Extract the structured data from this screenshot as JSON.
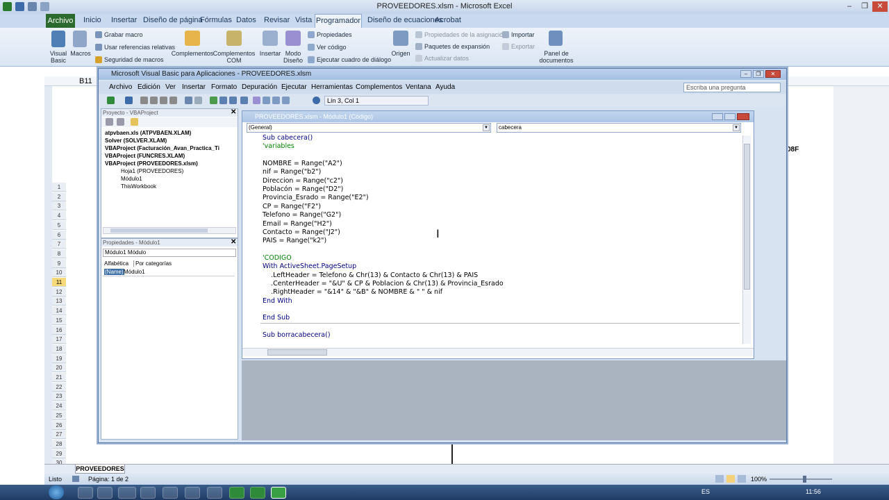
{
  "excel": {
    "title": "PROVEEDORES.xlsm - Microsoft Excel",
    "tabs": [
      "Inicio",
      "Insertar",
      "Diseño de página",
      "Fórmulas",
      "Datos",
      "Revisar",
      "Vista",
      "Programador",
      "Diseño de ecuaciones",
      "Acrobat"
    ],
    "file_tab": "Archivo",
    "ribbon": {
      "visual_basic": "Visual Basic",
      "macros": "Macros",
      "grabar": "Grabar macro",
      "relativas": "Usar referencias relativas",
      "seguridad": "Seguridad de macros",
      "complementos": "Complementos",
      "complementos_com": "Complementos COM",
      "insertar": "Insertar",
      "modo_diseno": "Modo Diseño",
      "propiedades": "Propiedades",
      "ver_codigo": "Ver código",
      "ejecutar": "Ejecutar cuadro de diálogo",
      "origen": "Origen",
      "prop_asig": "Propiedades de la asignación",
      "paquetes": "Paquetes de expansión",
      "actualizar": "Actualizar datos",
      "importar": "Importar",
      "exportar": "Exportar",
      "panel": "Panel de documentos"
    },
    "namebox": "B11",
    "cell_fragment": "08F",
    "rows": [
      "1",
      "2",
      "3",
      "4",
      "5",
      "6",
      "7",
      "8",
      "9",
      "10",
      "11",
      "12",
      "13",
      "14",
      "15",
      "16",
      "17",
      "18",
      "19",
      "20",
      "21",
      "22",
      "23",
      "24",
      "25",
      "26",
      "27",
      "28",
      "29",
      "30"
    ],
    "sheet_tab": "PROVEEDORES",
    "status": {
      "ready": "Listo",
      "page": "Página: 1 de 2",
      "zoom": "100%"
    },
    "clock": "11:56",
    "lang": "ES"
  },
  "vba": {
    "title": "Microsoft Visual Basic para Aplicaciones - PROVEEDORES.xlsm",
    "menus": [
      "Archivo",
      "Edición",
      "Ver",
      "Insertar",
      "Formato",
      "Depuración",
      "Ejecutar",
      "Herramientas",
      "Complementos",
      "Ventana",
      "Ayuda"
    ],
    "ask_placeholder": "Escriba una pregunta",
    "position": "Lín 3, Col 1",
    "project_title": "Proyecto - VBAProject",
    "tree": [
      "atpvbaen.xls (ATPVBAEN.XLAM)",
      "Solver (SOLVER.XLAM)",
      "VBAProject (Facturación_Avan_Practica_Ti",
      "VBAProject (FUNCRES.XLAM)",
      "VBAProject (PROVEEDORES.xlsm)",
      "Hoja1 (PROVEEDORES)",
      "Módulo1",
      "ThisWorkbook"
    ],
    "props_title": "Propiedades - Módulo1",
    "props_combo": "Módulo1 Módulo",
    "props_tabs": [
      "Alfabética",
      "Por categorías"
    ],
    "props_name_key": "(Name)",
    "props_name_val": "Módulo1",
    "code_title": "PROVEEDORES.xlsm - Módulo1 (Código)",
    "combo_left": "(General)",
    "combo_right": "cabecera",
    "code": [
      "Sub cabecera()",
      "'variables",
      "",
      "NOMBRE = Range(\"A2\")",
      "nif = Range(\"b2\")",
      "Direccion = Range(\"c2\")",
      "Poblacón = Range(\"D2\")",
      "Provincia_Esrado = Range(\"E2\")",
      "CP = Range(\"F2\")",
      "Telefono = Range(\"G2\")",
      "Email = Range(\"H2\")",
      "Contacto = Range(\"J2\")",
      "PAIS = Range(\"k2\")",
      "",
      "'CODIGO",
      "With ActiveSheet.PageSetup",
      "    .LeftHeader = Telefono & Chr(13) & Contacto & Chr(13) & PAIS",
      "    .CenterHeader = \"&U\" & CP & Poblacion & Chr(13) & Provincia_Esrado",
      "    .RightHeader = \"&14\" & \"&B\" & NOMBRE & \" \" & nif",
      "End With",
      "",
      "End Sub",
      "",
      "Sub borracabecera()"
    ]
  }
}
